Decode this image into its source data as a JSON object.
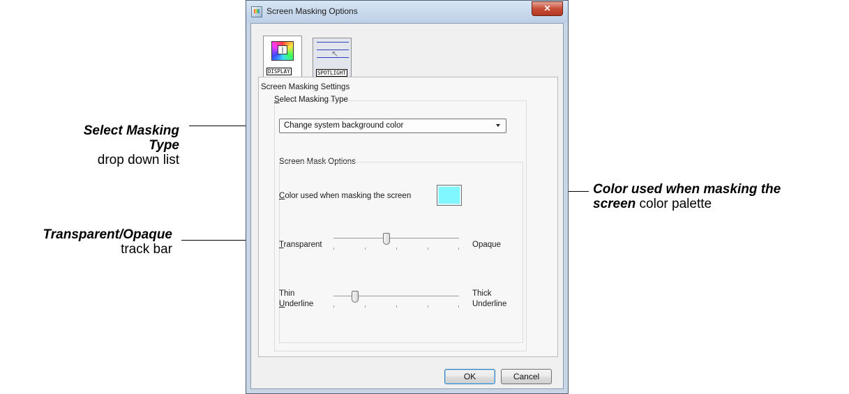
{
  "dialog": {
    "title": "Screen Masking Options",
    "close_symbol": "✕",
    "tabs": [
      {
        "label": "DISPLAY",
        "icon": "display-color-icon",
        "active": true
      },
      {
        "label": "SPOTLIGHT",
        "icon": "spotlight-lines-icon",
        "active": false
      }
    ],
    "settings_group_label": "Screen Masking Settings",
    "masking_type": {
      "label": "Select Masking Type",
      "selected": "Change system background color"
    },
    "mask_options_label": "Screen Mask Options",
    "color": {
      "label": "Color used when masking the screen",
      "value": "#80f6ff"
    },
    "transparency": {
      "left_label": "Transparent",
      "right_label": "Opaque",
      "level": 0.42
    },
    "underline": {
      "left_label_line1": "Thin",
      "left_label_line2": "Underline",
      "right_label_line1": "Thick",
      "right_label_line2": "Underline",
      "level": 0.17
    },
    "buttons": {
      "ok": "OK",
      "cancel": "Cancel"
    }
  },
  "callouts": {
    "masking_type": {
      "bold": "Select Masking Type",
      "rest": "drop down list"
    },
    "color": {
      "bold_line1": "Color used when masking the",
      "bold_line2": "screen",
      "rest": " color palette"
    },
    "transparency": {
      "bold": "Transparent/Opaque",
      "rest": "track bar"
    }
  }
}
